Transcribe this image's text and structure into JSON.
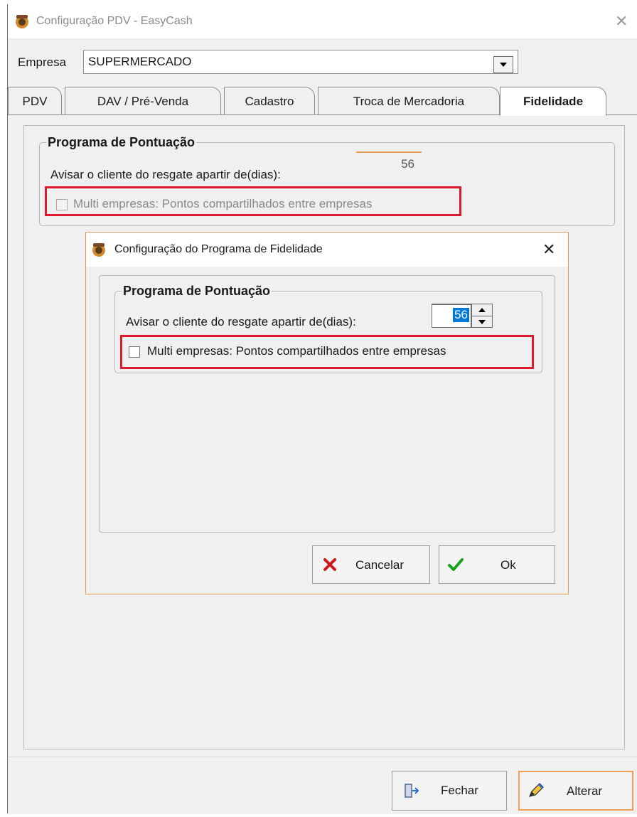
{
  "window": {
    "title": "Configuração PDV - EasyCash",
    "close_glyph": "✕"
  },
  "empresa": {
    "label": "Empresa",
    "value": "SUPERMERCADO"
  },
  "tabs": [
    {
      "label": "PDV",
      "active": false
    },
    {
      "label": "DAV / Pré-Venda",
      "active": false
    },
    {
      "label": "Cadastro",
      "active": false
    },
    {
      "label": "Troca de Mercadoria",
      "active": false
    },
    {
      "label": "Fidelidade",
      "active": true
    }
  ],
  "fidelidade": {
    "group_title": "Programa de Pontuação",
    "days_label": "Avisar o cliente do resgate apartir de(dias):",
    "days_value": "56",
    "multi_label": "Multi empresas: Pontos compartilhados entre empresas"
  },
  "dialog": {
    "title": "Configuração do Programa de Fidelidade",
    "close_glyph": "✕",
    "group_title": "Programa de Pontuação",
    "days_label": "Avisar o cliente do resgate apartir de(dias):",
    "days_value": "56",
    "multi_label": "Multi empresas: Pontos compartilhados entre empresas",
    "cancel_label": "Cancelar",
    "ok_label": "Ok"
  },
  "footer": {
    "close_label": "Fechar",
    "edit_label": "Alterar"
  },
  "colors": {
    "highlight": "#e01a2c",
    "focus": "#f0a050",
    "selection": "#0078d7"
  }
}
